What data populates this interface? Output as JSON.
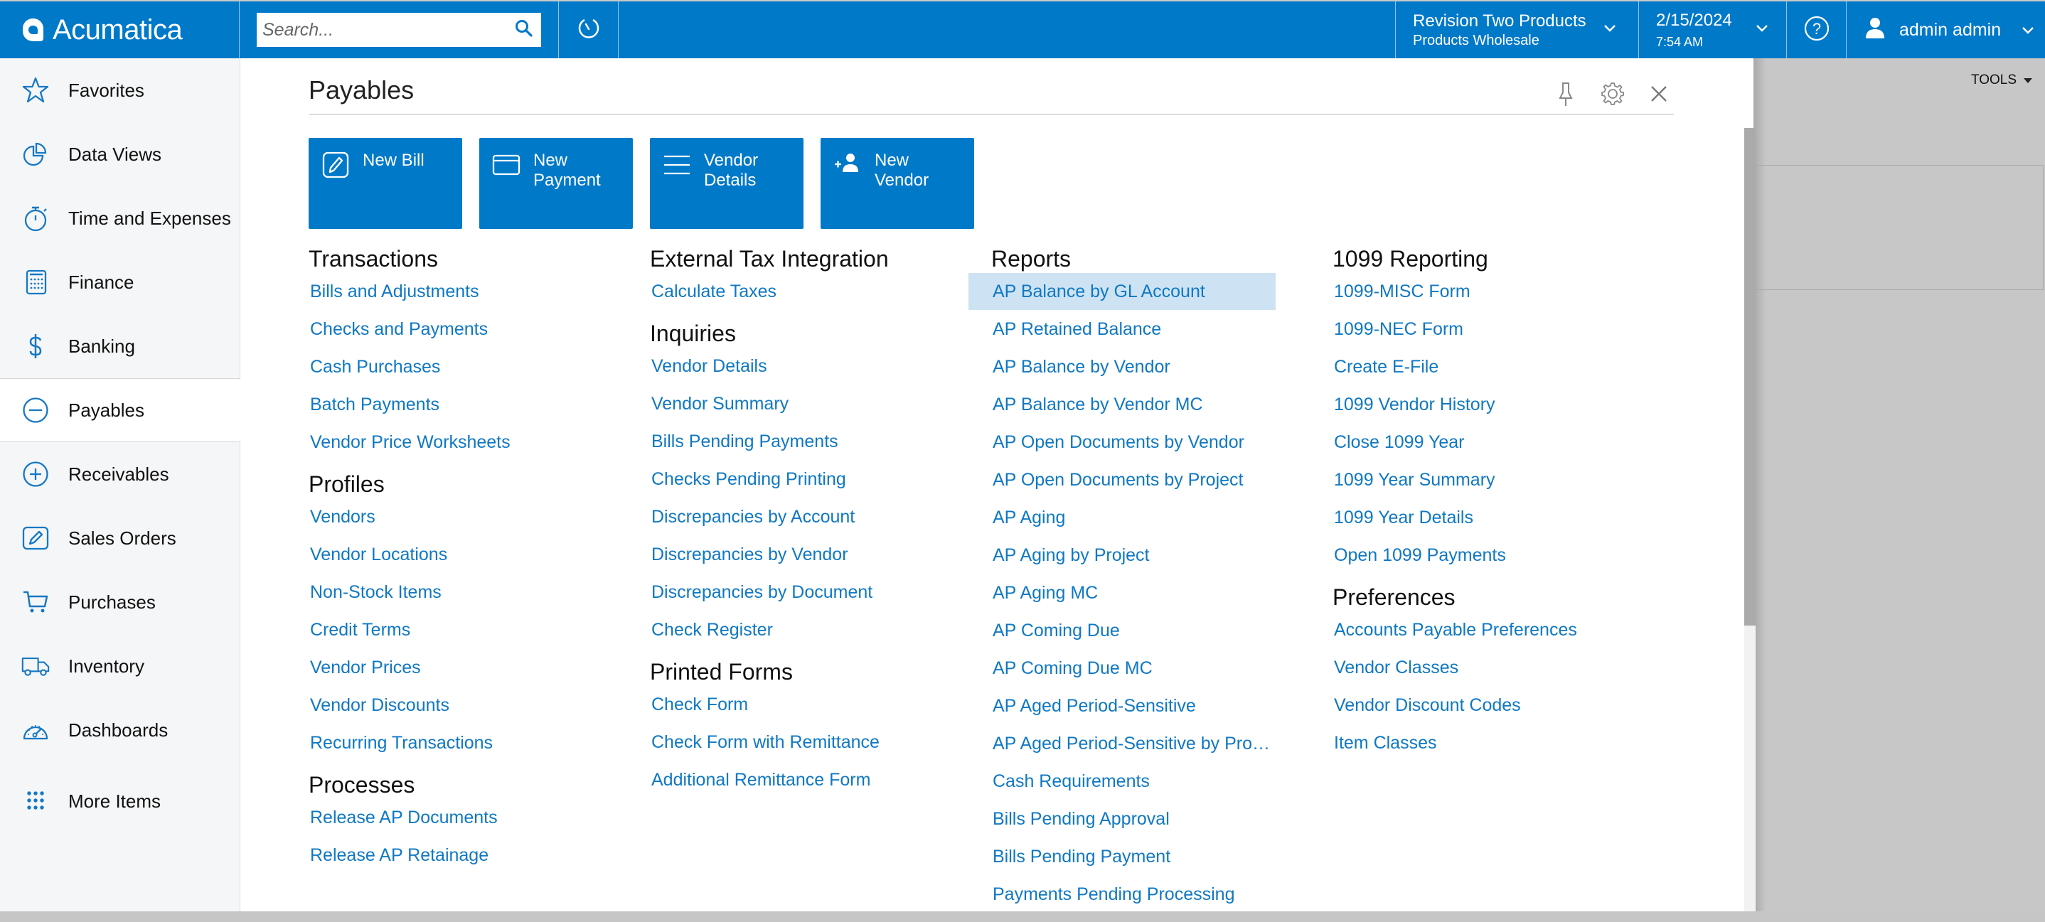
{
  "header": {
    "brand": "Acumatica",
    "search_placeholder": "Search...",
    "company_name": "Revision Two Products",
    "company_branch": "Products Wholesale",
    "date": "2/15/2024",
    "time": "7:54 AM",
    "user": "admin admin",
    "accent_color": "#0079c9"
  },
  "sidebar": {
    "items": [
      {
        "label": "Favorites",
        "icon": "star-icon"
      },
      {
        "label": "Data Views",
        "icon": "pie-chart-icon"
      },
      {
        "label": "Time and Expenses",
        "icon": "stopwatch-icon"
      },
      {
        "label": "Finance",
        "icon": "calculator-icon"
      },
      {
        "label": "Banking",
        "icon": "dollar-icon"
      },
      {
        "label": "Payables",
        "icon": "minus-circle-icon",
        "active": true
      },
      {
        "label": "Receivables",
        "icon": "plus-circle-icon"
      },
      {
        "label": "Sales Orders",
        "icon": "edit-square-icon"
      },
      {
        "label": "Purchases",
        "icon": "cart-icon"
      },
      {
        "label": "Inventory",
        "icon": "truck-icon"
      },
      {
        "label": "Dashboards",
        "icon": "gauge-icon"
      },
      {
        "label": "More Items",
        "icon": "grid-dots-icon"
      }
    ]
  },
  "panel": {
    "title": "Payables",
    "tiles": [
      {
        "label": "New Bill",
        "icon": "edit-icon"
      },
      {
        "label": "New Payment",
        "icon": "card-icon"
      },
      {
        "label": "Vendor Details",
        "icon": "list-icon"
      },
      {
        "label": "New Vendor",
        "icon": "add-user-icon"
      }
    ],
    "columns": [
      {
        "sections": [
          {
            "title": "Transactions",
            "links": [
              "Bills and Adjustments",
              "Checks and Payments",
              "Cash Purchases",
              "Batch Payments",
              "Vendor Price Worksheets"
            ]
          },
          {
            "title": "Profiles",
            "links": [
              "Vendors",
              "Vendor Locations",
              "Non-Stock Items",
              "Credit Terms",
              "Vendor Prices",
              "Vendor Discounts",
              "Recurring Transactions"
            ]
          },
          {
            "title": "Processes",
            "links": [
              "Release AP Documents",
              "Release AP Retainage"
            ]
          }
        ]
      },
      {
        "sections": [
          {
            "title": "External Tax Integration",
            "links": [
              "Calculate Taxes"
            ]
          },
          {
            "title": "Inquiries",
            "links": [
              "Vendor Details",
              "Vendor Summary",
              "Bills Pending Payments",
              "Checks Pending Printing",
              "Discrepancies by Account",
              "Discrepancies by Vendor",
              "Discrepancies by Document",
              "Check Register"
            ]
          },
          {
            "title": "Printed Forms",
            "links": [
              "Check Form",
              "Check Form with Remittance",
              "Additional Remittance Form"
            ]
          }
        ]
      },
      {
        "sections": [
          {
            "title": "Reports",
            "links": [
              "AP Balance by GL Account",
              "AP Retained Balance",
              "AP Balance by Vendor",
              "AP Balance by Vendor MC",
              "AP Open Documents by Vendor",
              "AP Open Documents by Project",
              "AP Aging",
              "AP Aging by Project",
              "AP Aging MC",
              "AP Coming Due",
              "AP Coming Due MC",
              "AP Aged Period-Sensitive",
              "AP Aged Period-Sensitive by Pro…",
              "Cash Requirements",
              "Bills Pending Approval",
              "Bills Pending Payment",
              "Payments Pending Processing"
            ],
            "highlighted_index": 0
          }
        ]
      },
      {
        "sections": [
          {
            "title": "1099 Reporting",
            "links": [
              "1099-MISC Form",
              "1099-NEC Form",
              "Create E-File",
              "1099 Vendor History",
              "Close 1099 Year",
              "1099 Year Summary",
              "1099 Year Details",
              "Open 1099 Payments"
            ]
          },
          {
            "title": "Preferences",
            "links": [
              "Accounts Payable Preferences",
              "Vendor Classes",
              "Vendor Discount Codes",
              "Item Classes"
            ]
          }
        ]
      }
    ]
  },
  "background": {
    "tools_label": "TOOLS"
  }
}
